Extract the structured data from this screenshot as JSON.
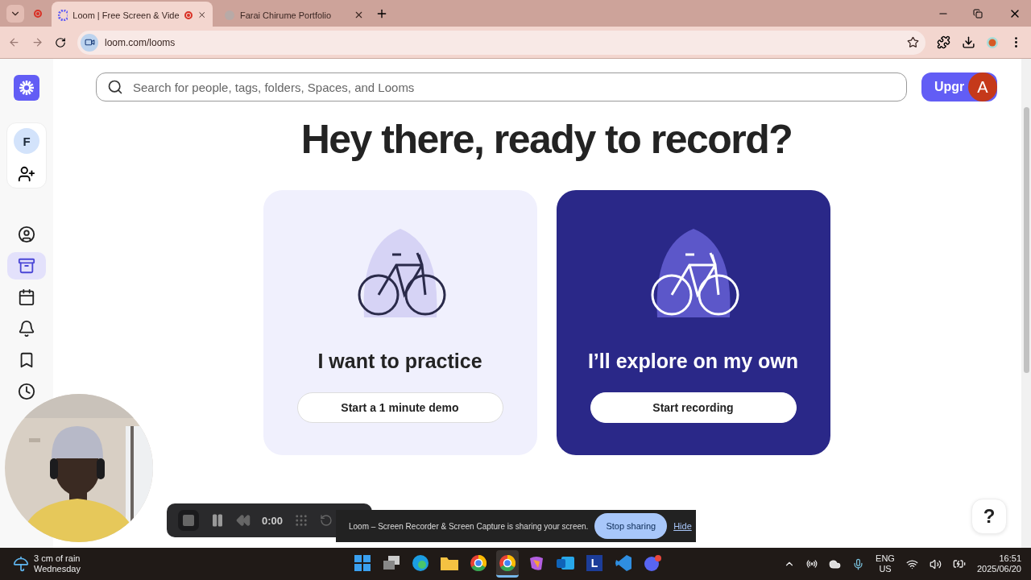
{
  "browser": {
    "tabs": [
      {
        "title": "Loom | Free Screen & Vide",
        "recording": true,
        "selected": true
      },
      {
        "title": "Farai Chirume Portfolio",
        "recording": false,
        "selected": false
      }
    ],
    "url": "loom.com/looms"
  },
  "sidebar": {
    "account_initial": "F",
    "items": [
      {
        "kind": "profile",
        "selected": false
      },
      {
        "kind": "library",
        "selected": true
      },
      {
        "kind": "calendar",
        "selected": false
      },
      {
        "kind": "notifications",
        "selected": false
      },
      {
        "kind": "bookmarks",
        "selected": false
      },
      {
        "kind": "history",
        "selected": false
      }
    ]
  },
  "search": {
    "placeholder": "Search for people, tags, folders, Spaces, and Looms"
  },
  "upgrade": {
    "label": "Upgr",
    "avatar": "A"
  },
  "heading": "Hey there, ready to record?",
  "cards": [
    {
      "kind": "light",
      "title": "I want to practice",
      "button": "Start a 1 minute demo"
    },
    {
      "kind": "dark",
      "title": "I’ll explore on my own",
      "button": "Start recording"
    }
  ],
  "recorder": {
    "time": "0:00"
  },
  "sharing_bar": {
    "message": "Loom – Screen Recorder & Screen Capture is sharing your screen.",
    "stop": "Stop sharing",
    "hide": "Hide"
  },
  "help": "?",
  "taskbar": {
    "weather": {
      "line1": "3 cm of rain",
      "line2": "Wednesday"
    },
    "apps": [
      {
        "kind": "start",
        "selected": false
      },
      {
        "kind": "windows",
        "selected": false
      },
      {
        "kind": "edge",
        "selected": false
      },
      {
        "kind": "folder",
        "selected": false
      },
      {
        "kind": "chrome",
        "selected": false
      },
      {
        "kind": "chrome",
        "selected": true
      },
      {
        "kind": "copilot",
        "selected": false
      },
      {
        "kind": "outlook",
        "selected": false
      },
      {
        "kind": "letter",
        "label": "L",
        "selected": false
      },
      {
        "kind": "vscode",
        "selected": false
      },
      {
        "kind": "discord",
        "selected": false
      }
    ],
    "language": [
      "ENG",
      "US"
    ],
    "time": "16:51",
    "date": "2025/06/20"
  }
}
